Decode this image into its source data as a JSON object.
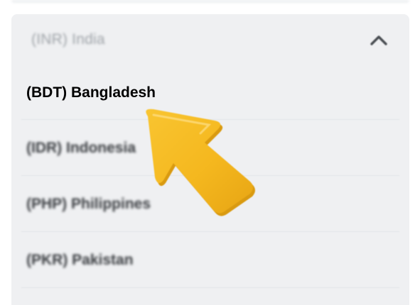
{
  "currency_select": {
    "selected_label": "(INR) India",
    "options": [
      {
        "label": "(BDT) Bangladesh"
      },
      {
        "label": "(IDR) Indonesia"
      },
      {
        "label": "(PHP) Philippines"
      },
      {
        "label": "(PKR) Pakistan"
      }
    ]
  },
  "colors": {
    "panel_background": "#eff0f2",
    "arrow_fill": "#f5b81f",
    "arrow_shadow": "#e09f12"
  },
  "icons": {
    "chevron": "chevron-up-icon",
    "pointer": "pointer-arrow-icon"
  }
}
